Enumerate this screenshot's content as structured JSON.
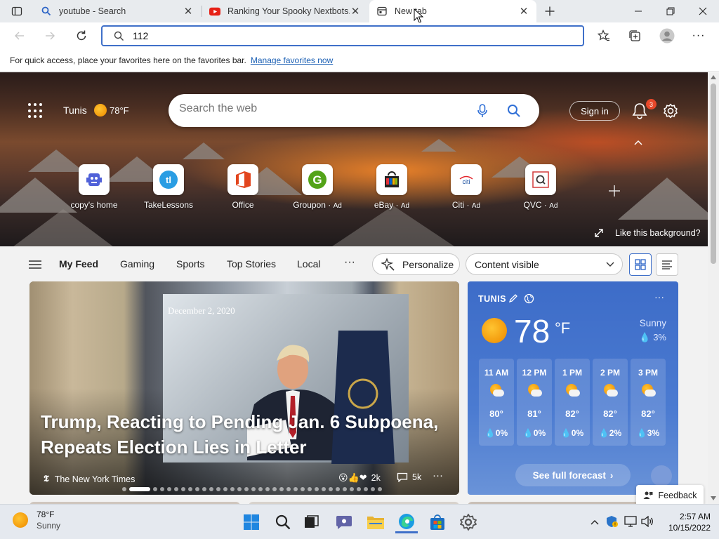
{
  "tabs": [
    {
      "title": "youtube - Search",
      "active": false
    },
    {
      "title": "Ranking Your Spooky Nextbots...",
      "active": false
    },
    {
      "title": "New tab",
      "active": true
    }
  ],
  "address": {
    "value": "112"
  },
  "favbar": {
    "text": "For quick access, place your favorites here on the favorites bar.",
    "link": "Manage favorites now"
  },
  "hero": {
    "city": "Tunis",
    "temp": "78°F",
    "search_placeholder": "Search the web",
    "sign_in": "Sign in",
    "notifications": "3",
    "like_background": "Like this background?"
  },
  "quicklinks": [
    {
      "label": "copy's home",
      "ad": ""
    },
    {
      "label": "TakeLessons",
      "ad": ""
    },
    {
      "label": "Office",
      "ad": ""
    },
    {
      "label": "Groupon",
      "ad": "Ad"
    },
    {
      "label": "eBay",
      "ad": "Ad"
    },
    {
      "label": "Citi",
      "ad": "Ad"
    },
    {
      "label": "QVC",
      "ad": "Ad"
    }
  ],
  "feednav": {
    "items": [
      "My Feed",
      "Gaming",
      "Sports",
      "Top Stories",
      "Local"
    ],
    "personalize": "Personalize",
    "content_visible": "Content visible"
  },
  "news": {
    "date": "December 2, 2020",
    "title": "Trump, Reacting to Pending Jan. 6 Subpoena, Repeats Election Lies in Letter",
    "source": "The New York Times",
    "reactions": "2k",
    "comments": "5k"
  },
  "weather": {
    "city": "TUNIS",
    "temp": "78",
    "unit": "°F",
    "condition": "Sunny",
    "precip": "3%",
    "hours": [
      {
        "time": "11 AM",
        "temp": "80°",
        "precip": "0%"
      },
      {
        "time": "12 PM",
        "temp": "81°",
        "precip": "0%"
      },
      {
        "time": "1 PM",
        "temp": "82°",
        "precip": "0%"
      },
      {
        "time": "2 PM",
        "temp": "82°",
        "precip": "2%"
      },
      {
        "time": "3 PM",
        "temp": "82°",
        "precip": "3%"
      }
    ],
    "see_full": "See full forecast"
  },
  "feedback": "Feedback",
  "taskbar": {
    "weather_temp": "78°F",
    "weather_cond": "Sunny",
    "time": "2:57 AM",
    "date": "10/15/2022"
  },
  "colors": {
    "accent": "#3f70c9",
    "weather_bg": "#4b7bd1",
    "badge": "#e8482a"
  }
}
